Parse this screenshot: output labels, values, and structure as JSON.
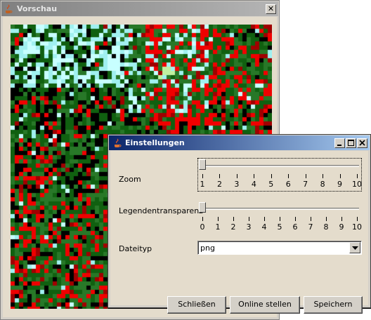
{
  "preview_window": {
    "title": "Vorschau",
    "close_glyph": "✕"
  },
  "settings_dialog": {
    "title": "Einstellungen",
    "controls": [
      "minimize",
      "maximize",
      "close"
    ],
    "zoom": {
      "label": "Zoom",
      "value": 1,
      "min": 1,
      "max": 10,
      "ticks": [
        "1",
        "2",
        "3",
        "4",
        "5",
        "6",
        "7",
        "8",
        "9",
        "10"
      ]
    },
    "legend_transparency": {
      "label": "Legendentransparenz",
      "value": 0,
      "min": 0,
      "max": 10,
      "ticks": [
        "0",
        "1",
        "2",
        "3",
        "4",
        "5",
        "6",
        "7",
        "8",
        "9",
        "10"
      ]
    },
    "file_type": {
      "label": "Dateityp",
      "value": "png"
    },
    "buttons": {
      "close": "Schließen",
      "publish": "Online stellen",
      "save": "Speichern"
    }
  },
  "map_colors": {
    "black": "#000000",
    "dark_green": "#106010",
    "green": "#287828",
    "cyan": "#a0f0f0",
    "light_cyan": "#c8ffff",
    "red": "#f00000",
    "dark_red": "#a00000",
    "light_green": "#c0f0a0"
  }
}
